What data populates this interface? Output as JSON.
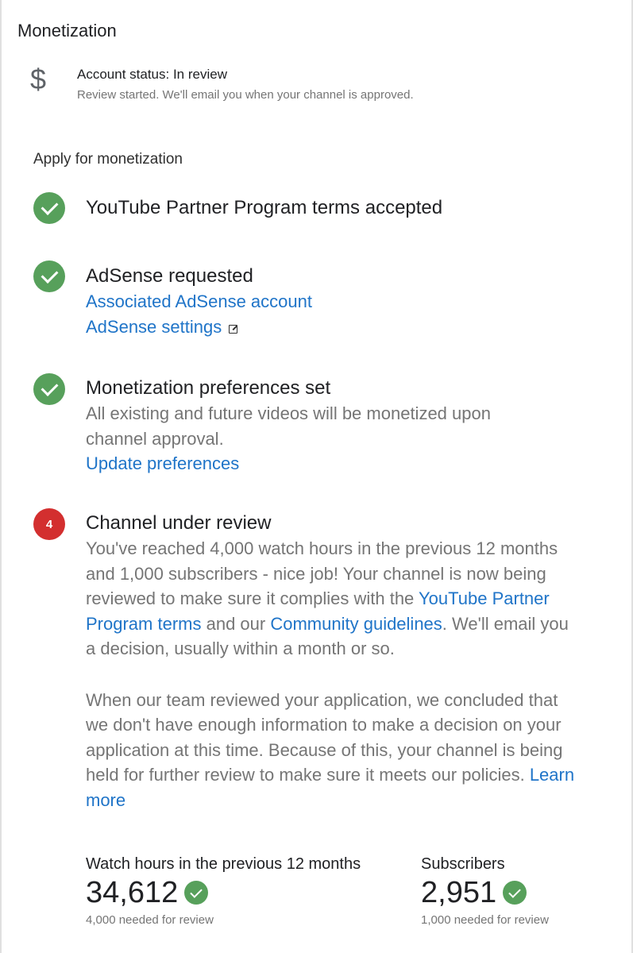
{
  "page_title": "Monetization",
  "account": {
    "icon": "dollar-icon",
    "glyph": "$",
    "status": "Account status: In review",
    "message": "Review started. We'll email you when your channel is approved."
  },
  "apply_heading": "Apply for monetization",
  "steps": [
    {
      "title": "YouTube Partner Program terms accepted",
      "status": "done"
    },
    {
      "title": "AdSense requested",
      "status": "done",
      "links": [
        "Associated AdSense account",
        "AdSense settings"
      ]
    },
    {
      "title": "Monetization preferences set",
      "status": "done",
      "text": "All existing and future videos will be monetized upon channel approval.",
      "link": "Update preferences"
    },
    {
      "number": "4",
      "title": "Channel under review",
      "status": "pending",
      "text_before": "You've reached 4,000 watch hours in the previous 12 months and 1,000 subscribers - nice job! Your channel is now being reviewed to make sure it complies with the",
      "terms_link": "YouTube Partner Program terms",
      "text_and": "and our",
      "guidelines_link": "Community guidelines",
      "text_after": ". We'll email you a decision, usually within a month or so.",
      "review_text": "When our team reviewed your application, we concluded that we don't have enough information to make a decision on your application at this time. Because of this, your channel is being held for further review to make sure it meets our policies.",
      "learn_more": "Learn more"
    }
  ],
  "stats": {
    "watch_hours": {
      "label": "Watch hours in the previous 12 months",
      "value": "34,612",
      "note": "4,000 needed for review"
    },
    "subscribers": {
      "label": "Subscribers",
      "value": "2,951",
      "note": "1,000 needed for review"
    }
  },
  "colors": {
    "success": "#57a05b",
    "alert": "#d32f2f",
    "link": "#1f74c8",
    "secondary_text": "#757575"
  }
}
